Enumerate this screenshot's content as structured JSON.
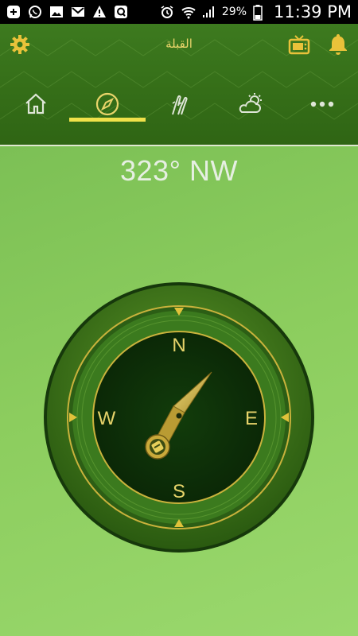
{
  "status_bar": {
    "icons": [
      "add-icon",
      "whatsapp-icon",
      "image-icon",
      "gmail-icon",
      "warning-icon",
      "app-q-icon",
      "alarm-icon",
      "wifi-icon",
      "signal-icon"
    ],
    "battery": "29%",
    "time": "11:39 PM"
  },
  "header": {
    "title": "القبلة",
    "icons": [
      "gear-icon",
      "tv-icon",
      "bell-icon"
    ],
    "accent_color": "#e9d46a"
  },
  "tabs": [
    {
      "name": "home",
      "icon": "home-icon"
    },
    {
      "name": "qibla",
      "icon": "compass-icon",
      "active": true
    },
    {
      "name": "prayer",
      "icon": "praying-hands-icon"
    },
    {
      "name": "weather",
      "icon": "weather-icon"
    },
    {
      "name": "more",
      "icon": "more-icon"
    }
  ],
  "compass": {
    "heading": "323° NW",
    "directions": {
      "north": "N",
      "south": "S",
      "east": "E",
      "west": "W"
    }
  },
  "colors": {
    "header_green": "#356e18",
    "background_green": "#8ccd5e",
    "gold": "#c9b23c",
    "indicator": "#f0e14a"
  }
}
